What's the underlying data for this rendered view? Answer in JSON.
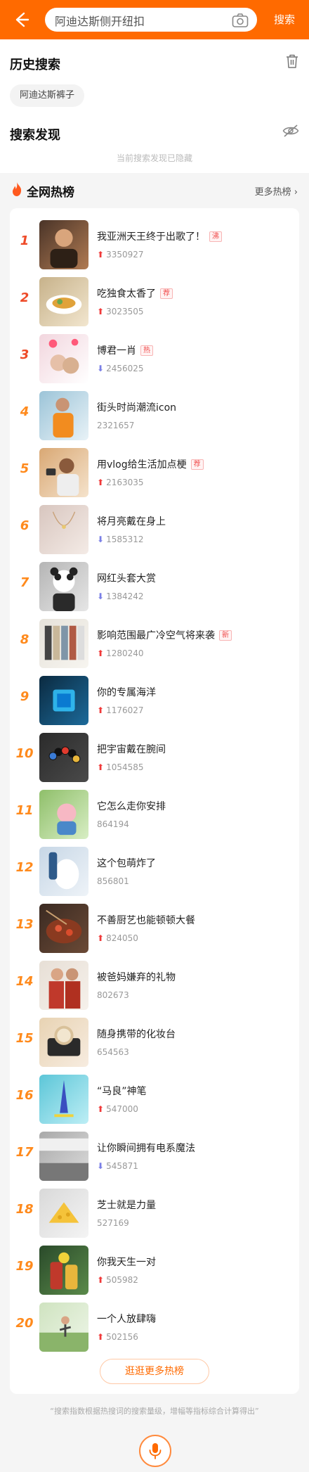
{
  "search": {
    "value": "阿迪达斯侧开纽扣",
    "button_label": "搜索"
  },
  "history": {
    "title": "历史搜索",
    "tags": [
      "阿迪达斯裤子"
    ]
  },
  "discover": {
    "title": "搜索发现",
    "hidden_note": "当前搜索发现已隐藏"
  },
  "hot": {
    "title": "全网热榜",
    "more_label": "更多热榜 ›",
    "more_button": "逛逛更多热榜",
    "items": [
      {
        "rank": "1",
        "title": "我亚洲天王终于出歌了！",
        "badge": "沸",
        "trend": "up",
        "count": "3350927"
      },
      {
        "rank": "2",
        "title": "吃独食太香了",
        "badge": "荐",
        "trend": "up",
        "count": "3023505"
      },
      {
        "rank": "3",
        "title": "博君一肖",
        "badge": "热",
        "trend": "down",
        "count": "2456025"
      },
      {
        "rank": "4",
        "title": "街头时尚潮流icon",
        "badge": "",
        "trend": "none",
        "count": "2321657"
      },
      {
        "rank": "5",
        "title": "用vlog给生活加点梗",
        "badge": "荐",
        "trend": "up",
        "count": "2163035"
      },
      {
        "rank": "6",
        "title": "将月亮戴在身上",
        "badge": "",
        "trend": "down",
        "count": "1585312"
      },
      {
        "rank": "7",
        "title": "网红头套大赏",
        "badge": "",
        "trend": "down",
        "count": "1384242"
      },
      {
        "rank": "8",
        "title": "影响范围最广冷空气将来袭",
        "badge": "新",
        "trend": "up",
        "count": "1280240"
      },
      {
        "rank": "9",
        "title": "你的专属海洋",
        "badge": "",
        "trend": "up",
        "count": "1176027"
      },
      {
        "rank": "10",
        "title": "把宇宙戴在腕间",
        "badge": "",
        "trend": "up",
        "count": "1054585"
      },
      {
        "rank": "11",
        "title": "它怎么走你安排",
        "badge": "",
        "trend": "none",
        "count": "864194"
      },
      {
        "rank": "12",
        "title": "这个包萌炸了",
        "badge": "",
        "trend": "none",
        "count": "856801"
      },
      {
        "rank": "13",
        "title": "不善厨艺也能顿顿大餐",
        "badge": "",
        "trend": "up",
        "count": "824050"
      },
      {
        "rank": "14",
        "title": "被爸妈嫌弃的礼物",
        "badge": "",
        "trend": "none",
        "count": "802673"
      },
      {
        "rank": "15",
        "title": "随身携带的化妆台",
        "badge": "",
        "trend": "none",
        "count": "654563"
      },
      {
        "rank": "16",
        "title": "“马良”神笔",
        "badge": "",
        "trend": "up",
        "count": "547000"
      },
      {
        "rank": "17",
        "title": "让你瞬间拥有电系魔法",
        "badge": "",
        "trend": "down",
        "count": "545871"
      },
      {
        "rank": "18",
        "title": "芝士就是力量",
        "badge": "",
        "trend": "none",
        "count": "527169"
      },
      {
        "rank": "19",
        "title": "你我天生一对",
        "badge": "",
        "trend": "up",
        "count": "505982"
      },
      {
        "rank": "20",
        "title": "一个人放肆嗨",
        "badge": "",
        "trend": "up",
        "count": "502156"
      }
    ]
  },
  "footnote": "“搜索指数根据热搜词的搜索量级，增幅等指标综合计算得出”",
  "colors": {
    "accent": "#ff6a00",
    "rank_top": "#ee4a28",
    "rank_other": "#ff8a1c",
    "trend_up": "#f03a3a",
    "trend_down": "#7a7fe6"
  },
  "icons": [
    "back-arrow-icon",
    "camera-icon",
    "trash-icon",
    "eye-off-icon",
    "fire-icon",
    "microphone-icon"
  ]
}
